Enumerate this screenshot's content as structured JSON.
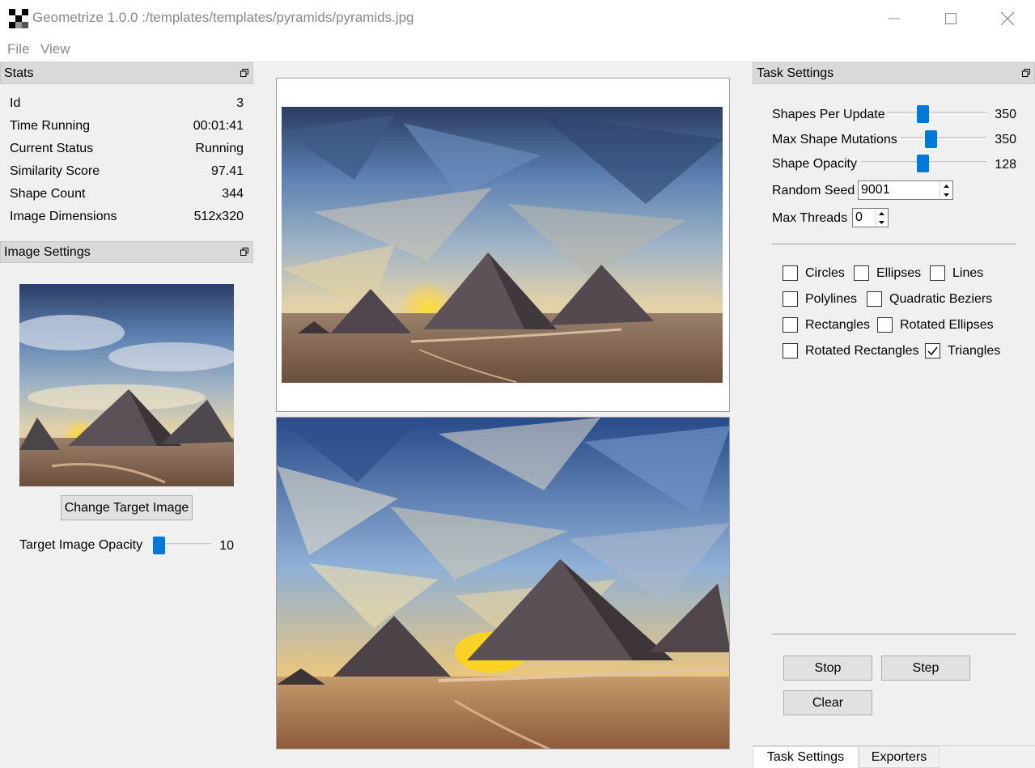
{
  "window": {
    "title": "Geometrize 1.0.0 :/templates/templates/pyramids/pyramids.jpg",
    "icons": [
      "app-icon",
      "minimize-icon",
      "maximize-icon",
      "close-icon"
    ]
  },
  "menu": {
    "file": "File",
    "view": "View"
  },
  "stats": {
    "title": "Stats",
    "rows": [
      {
        "label": "Id",
        "value": "3"
      },
      {
        "label": "Time Running",
        "value": "00:01:41"
      },
      {
        "label": "Current Status",
        "value": "Running"
      },
      {
        "label": "Similarity Score",
        "value": "97.41"
      },
      {
        "label": "Shape Count",
        "value": "344"
      },
      {
        "label": "Image Dimensions",
        "value": "512x320"
      }
    ]
  },
  "image_settings": {
    "title": "Image Settings",
    "change_button": "Change Target Image",
    "opacity_label": "Target Image Opacity",
    "opacity_value": "10",
    "opacity_fraction": 0.04
  },
  "task_settings": {
    "title": "Task Settings",
    "shapes_per_update": {
      "label": "Shapes Per Update",
      "value": "350",
      "fraction": 0.35
    },
    "max_shape_mutations": {
      "label": "Max Shape Mutations",
      "value": "350",
      "fraction": 0.35
    },
    "shape_opacity": {
      "label": "Shape Opacity",
      "value": "128",
      "fraction": 0.5
    },
    "random_seed": {
      "label": "Random Seed",
      "value": "9001"
    },
    "max_threads": {
      "label": "Max Threads",
      "value": "0"
    },
    "shapes": [
      {
        "label": "Circles",
        "checked": false
      },
      {
        "label": "Ellipses",
        "checked": false
      },
      {
        "label": "Lines",
        "checked": false
      },
      {
        "label": "Polylines",
        "checked": false
      },
      {
        "label": "Quadratic Beziers",
        "checked": false
      },
      {
        "label": "Rectangles",
        "checked": false
      },
      {
        "label": "Rotated Ellipses",
        "checked": false
      },
      {
        "label": "Rotated Rectangles",
        "checked": false
      },
      {
        "label": "Triangles",
        "checked": true
      }
    ],
    "buttons": {
      "stop": "Stop",
      "step": "Step",
      "clear": "Clear"
    }
  },
  "tabs": [
    {
      "label": "Task Settings",
      "active": true
    },
    {
      "label": "Exporters",
      "active": false
    }
  ],
  "colors": {
    "accent": "#0078d7",
    "panel_header": "#d9d9d9",
    "background": "#f0f0f0"
  }
}
